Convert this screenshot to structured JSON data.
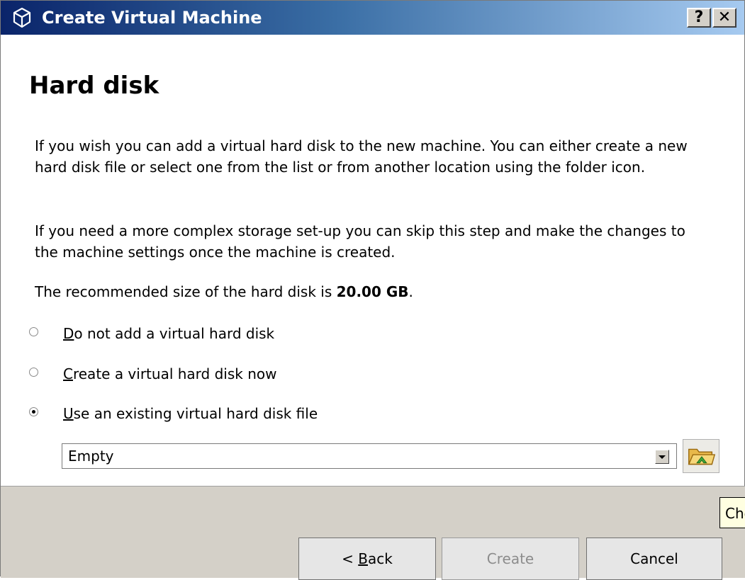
{
  "window": {
    "title": "Create Virtual Machine",
    "help_label": "?",
    "close_label": "✕"
  },
  "page": {
    "heading": "Hard disk",
    "para1": "If you wish you can add a virtual hard disk to the new machine. You can either create a new hard disk file or select one from the list or from another location using the folder icon.",
    "para2": "If you need a more complex storage set-up you can skip this step and make the changes to the machine settings once the machine is created.",
    "para3_prefix": "The recommended size of the hard disk is ",
    "para3_size": "20.00 GB",
    "para3_suffix": "."
  },
  "options": [
    {
      "mnemonic": "D",
      "rest": "o not add a virtual hard disk",
      "checked": false
    },
    {
      "mnemonic": "C",
      "rest": "reate a virtual hard disk now",
      "checked": false
    },
    {
      "mnemonic": "U",
      "rest": "se an existing virtual hard disk file",
      "checked": true
    }
  ],
  "disk_select": {
    "value": "Empty"
  },
  "buttons": {
    "back_prefix": "< ",
    "back_mnemonic": "B",
    "back_rest": "ack",
    "create": "Create",
    "cancel": "Cancel"
  },
  "tooltip": {
    "text": "Cho"
  },
  "colors": {
    "titlebar_start": "#0a246a",
    "titlebar_end": "#a6caf0",
    "footer_bg": "#d4d0c8",
    "tooltip_bg": "#ffffe1",
    "disabled_text": "#8c8c8c"
  },
  "icons": {
    "app": "virtualbox-cube-icon",
    "folder": "folder-open-icon"
  }
}
